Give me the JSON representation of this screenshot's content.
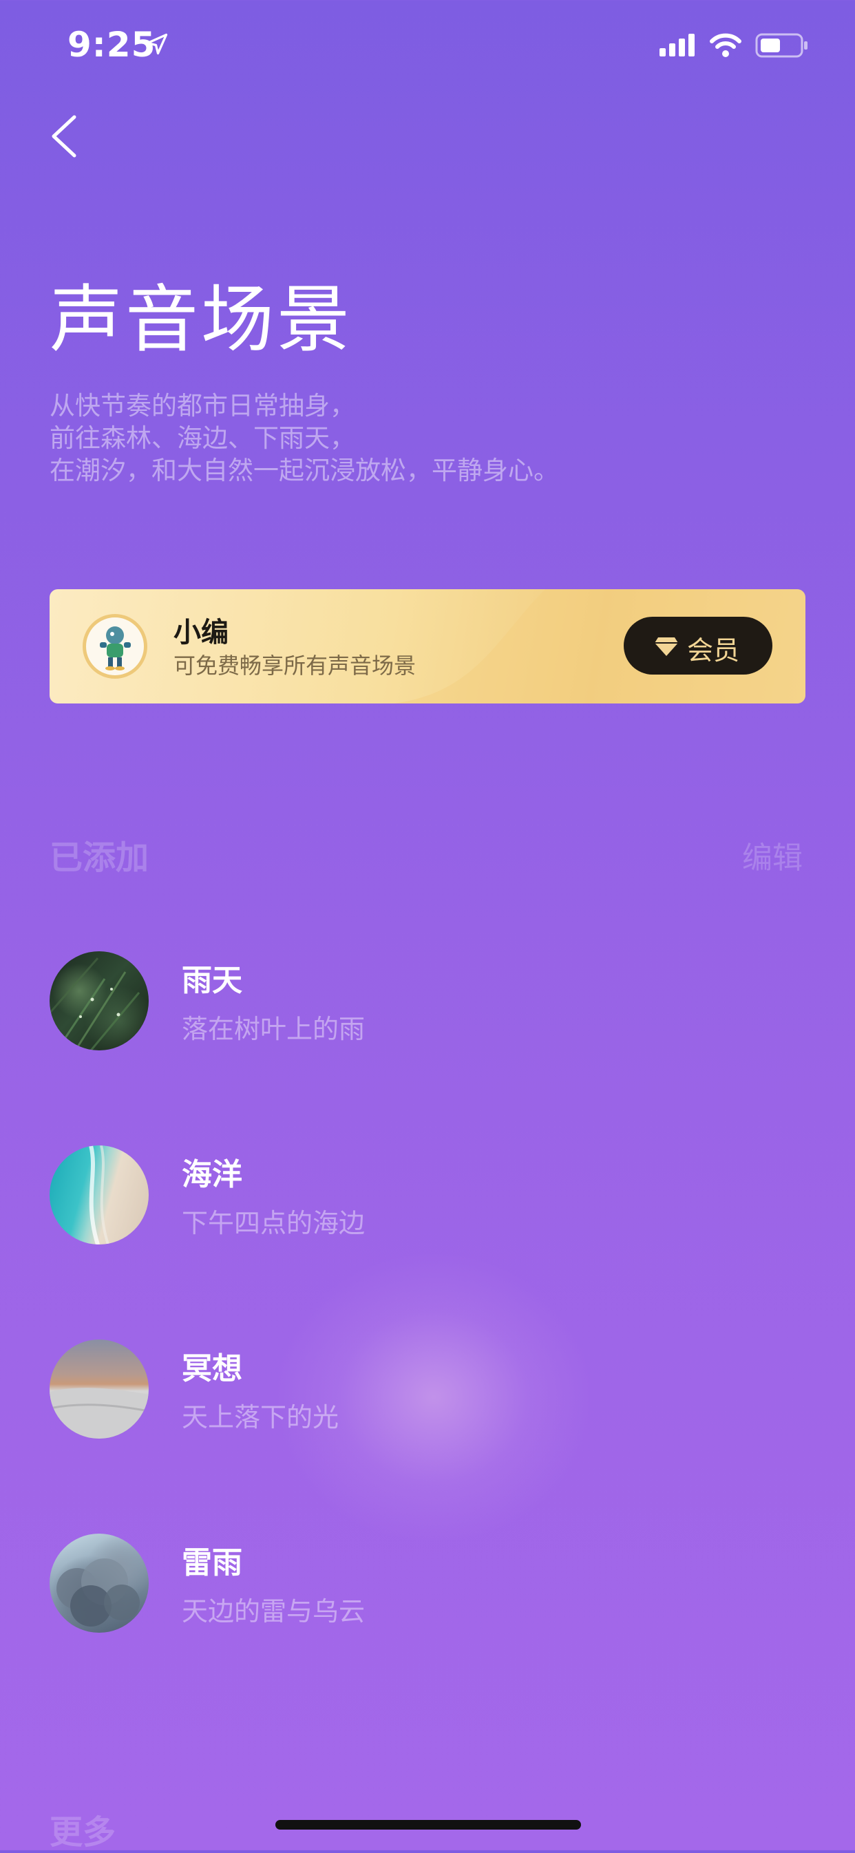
{
  "status_bar": {
    "time": "9:25"
  },
  "header": {
    "title": "声音场景",
    "description": [
      "从快节奏的都市日常抽身，",
      "前往森林、海边、下雨天，",
      "在潮汐，和大自然一起沉浸放松，平静身心。"
    ]
  },
  "member_card": {
    "name": "小编",
    "subtitle": "可免费畅享所有声音场景",
    "button_label": "会员"
  },
  "added_section": {
    "title": "已添加",
    "edit_label": "编辑",
    "items": [
      {
        "title": "雨天",
        "subtitle": "落在树叶上的雨",
        "thumb": "rain-leaves"
      },
      {
        "title": "海洋",
        "subtitle": "下午四点的海边",
        "thumb": "ocean-beach"
      },
      {
        "title": "冥想",
        "subtitle": "天上落下的光",
        "thumb": "desert-sky"
      },
      {
        "title": "雷雨",
        "subtitle": "天边的雷与乌云",
        "thumb": "storm-clouds"
      }
    ]
  },
  "more_section": {
    "title": "更多"
  },
  "colors": {
    "background_top": "#7e5de2",
    "background_bottom": "#a468ea",
    "card_gold": "#f8df9e",
    "vip_button": "#1f1a14",
    "vip_text": "#f2d595"
  }
}
